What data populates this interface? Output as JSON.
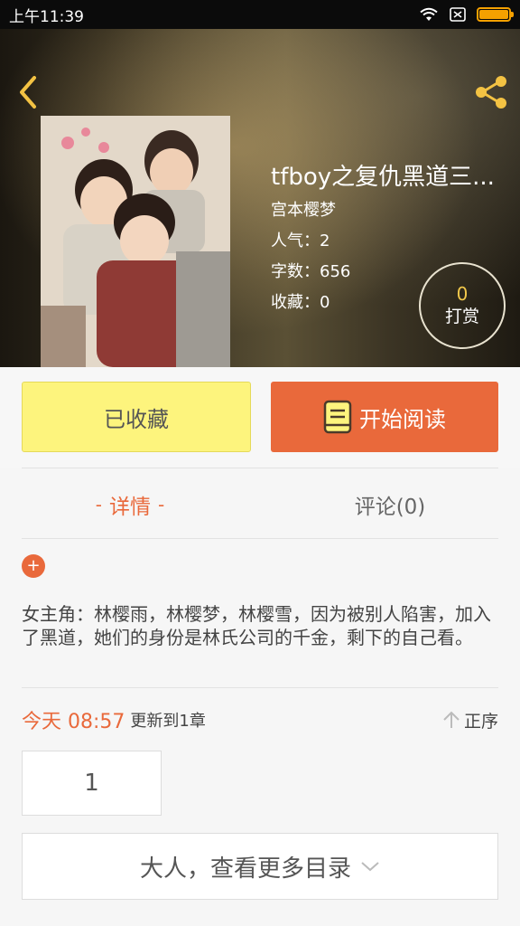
{
  "status_bar": {
    "time": "上午11:39"
  },
  "book": {
    "title": "tfboy之复仇黑道三...",
    "author": "宫本樱梦",
    "popularity": "人气：2",
    "word_count": "字数：656",
    "favorites": "收藏：0"
  },
  "tip": {
    "count": "0",
    "label": "打赏"
  },
  "actions": {
    "favorited_label": "已收藏",
    "read_label": "开始阅读"
  },
  "tabs": [
    {
      "label": "详情"
    },
    {
      "label": "评论(0)"
    }
  ],
  "expand_symbol": "+",
  "synopsis": "女主角：林樱雨，林樱梦，林樱雪，因为被别人陷害，加入了黑道，她们的身份是林氏公司的千金，剩下的自己看。",
  "update": {
    "time": "今天 08:57",
    "text": "更新到1章",
    "sort_label": "正序"
  },
  "chapter": {
    "number": "1"
  },
  "more_label": "大人，查看更多目录",
  "colors": {
    "accent": "#e9693b",
    "favorite_bg": "#fdf47d",
    "tip_gold": "#f2c84b",
    "battery": "#f4a000"
  },
  "icons": [
    "wifi-icon",
    "sim-icon",
    "battery-icon",
    "back-icon",
    "share-icon",
    "book-icon",
    "arrow-up-icon",
    "chevron-down-icon"
  ]
}
